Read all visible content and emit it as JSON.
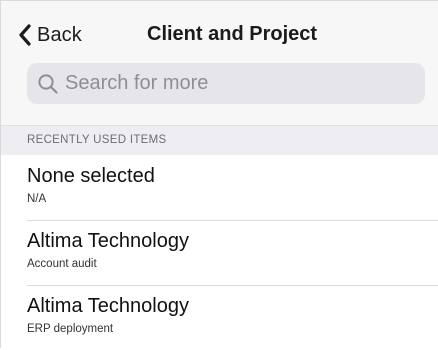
{
  "nav": {
    "back_label": "Back",
    "title": "Client and Project"
  },
  "search": {
    "placeholder": "Search for more"
  },
  "section": {
    "header": "RECENTLY USED ITEMS"
  },
  "items": [
    {
      "title": "None selected",
      "subtitle": "N/A"
    },
    {
      "title": "Altima Technology",
      "subtitle": "Account audit"
    },
    {
      "title": "Altima Technology",
      "subtitle": "ERP deployment"
    }
  ],
  "icons": {
    "back": "chevron-left-icon",
    "search": "search-icon"
  },
  "colors": {
    "nav_background": "#f7f7f8",
    "search_background": "#e6e6ea",
    "placeholder": "#8e8e93",
    "section_background": "#eeeef2"
  }
}
